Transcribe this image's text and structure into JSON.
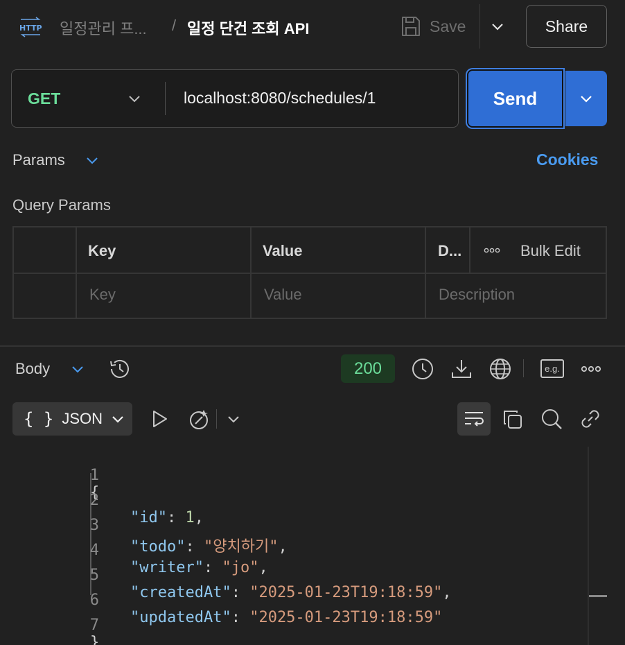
{
  "header": {
    "protocol_icon": "http-icon",
    "breadcrumb_parent": "일정관리 프...",
    "breadcrumb_sep": "/",
    "request_title": "일정 단건 조회 API",
    "save_label": "Save",
    "share_label": "Share"
  },
  "request": {
    "method": "GET",
    "url": "localhost:8080/schedules/1",
    "send_label": "Send"
  },
  "params": {
    "tab_label": "Params",
    "cookies_label": "Cookies",
    "query_params_label": "Query Params",
    "columns": [
      "Key",
      "Value",
      "D...",
      "Bulk Edit"
    ],
    "placeholders": {
      "key": "Key",
      "value": "Value",
      "description": "Description"
    }
  },
  "response": {
    "body_label": "Body",
    "status_code": "200",
    "format_label": "JSON",
    "format_icon": "{ }",
    "eg_label": "e.g."
  },
  "code": {
    "line_numbers": [
      "1",
      "2",
      "3",
      "4",
      "5",
      "6",
      "7"
    ],
    "open_brace": "{",
    "close_brace": "}",
    "fields": [
      {
        "key": "\"id\"",
        "value": "1",
        "type": "number",
        "comma": ","
      },
      {
        "key": "\"todo\"",
        "value": "\"양치하기\"",
        "type": "string",
        "comma": ","
      },
      {
        "key": "\"writer\"",
        "value": "\"jo\"",
        "type": "string",
        "comma": ","
      },
      {
        "key": "\"createdAt\"",
        "value": "\"2025-01-23T19:18:59\"",
        "type": "string",
        "comma": ","
      },
      {
        "key": "\"updatedAt\"",
        "value": "\"2025-01-23T19:18:59\"",
        "type": "string",
        "comma": ""
      }
    ]
  },
  "colors": {
    "background": "#212121",
    "accent": "#2f6ed5",
    "method_get": "#6bdd9a",
    "link": "#4a9bf0",
    "json_key": "#8fc7ee",
    "json_string": "#d69b7d",
    "json_number": "#bcd4a8"
  }
}
